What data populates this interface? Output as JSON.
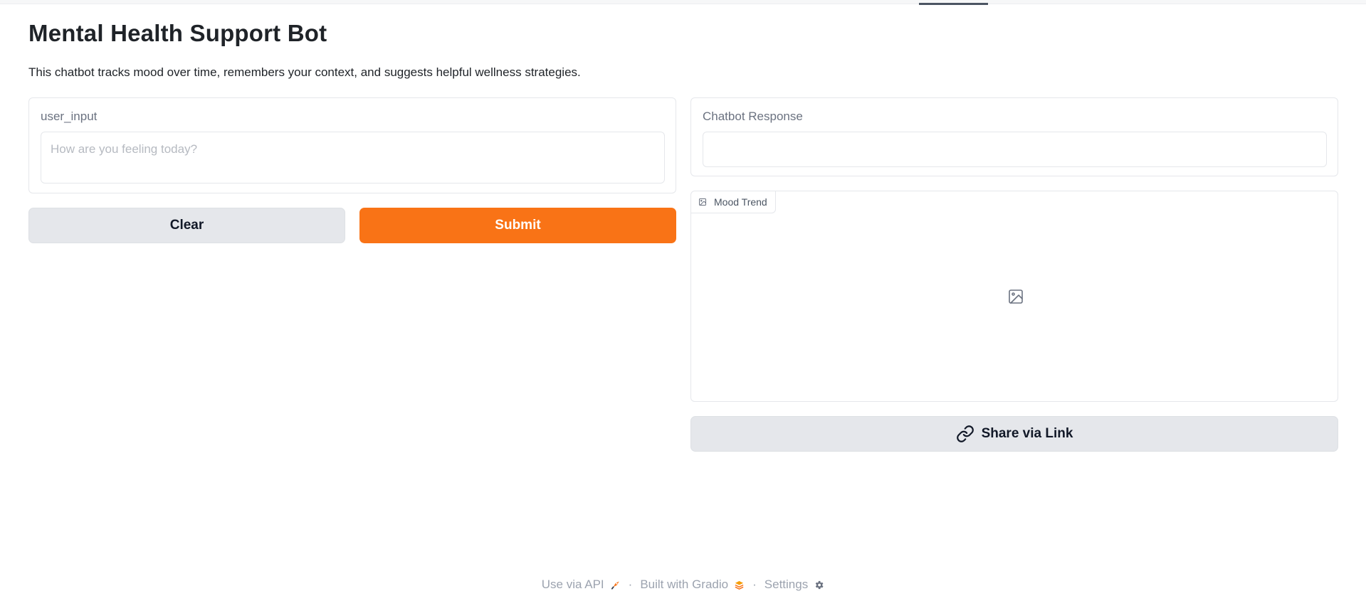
{
  "header": {
    "title": "Mental Health Support Bot",
    "description": "This chatbot tracks mood over time, remembers your context, and suggests helpful wellness strategies."
  },
  "input": {
    "label": "user_input",
    "placeholder": "How are you feeling today?",
    "value": ""
  },
  "buttons": {
    "clear": "Clear",
    "submit": "Submit",
    "share": "Share via Link"
  },
  "response": {
    "label": "Chatbot Response",
    "value": ""
  },
  "mood": {
    "label": "Mood Trend",
    "label_icon": "image-icon",
    "empty_icon": "image-placeholder-icon"
  },
  "footer": {
    "api": "Use via API",
    "api_icon": "rocket-icon",
    "separator": "·",
    "built": "Built with Gradio",
    "built_icon": "gradio-logo-icon",
    "settings": "Settings",
    "settings_icon": "gear-icon"
  },
  "colors": {
    "accent": "#f97316",
    "secondary_button": "#e5e7eb",
    "border": "#e5e7eb"
  }
}
